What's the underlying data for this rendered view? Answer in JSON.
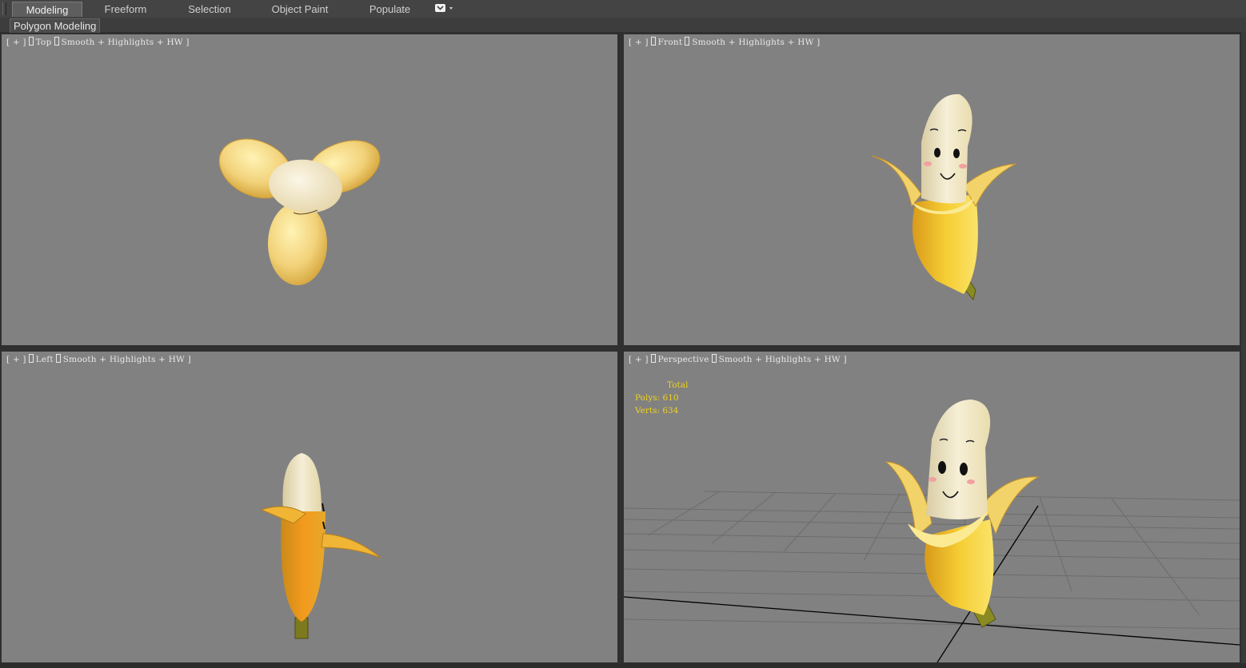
{
  "ribbon": {
    "tabs": [
      {
        "label": "Modeling",
        "active": true
      },
      {
        "label": "Freeform",
        "active": false
      },
      {
        "label": "Selection",
        "active": false
      },
      {
        "label": "Object Paint",
        "active": false
      },
      {
        "label": "Populate",
        "active": false
      }
    ],
    "menu_icon": "dropdown-toggle-icon",
    "panel_label": "Polygon Modeling"
  },
  "viewports": {
    "top": {
      "plus": "[ + ]",
      "view": "Top",
      "shading": "Smooth + Highlights + HW ]"
    },
    "front": {
      "plus": "[ + ]",
      "view": "Front",
      "shading": "Smooth + Highlights + HW ]"
    },
    "left": {
      "plus": "[ + ]",
      "view": "Left",
      "shading": "Smooth + Highlights + HW ]"
    },
    "perspective": {
      "plus": "[ + ]",
      "view": "Perspective",
      "shading": "Smooth + Highlights + HW ]"
    }
  },
  "stats": {
    "header": "Total",
    "polys_label": "Polys:",
    "polys": "610",
    "verts_label": "Verts:",
    "verts": "634"
  },
  "colors": {
    "viewport_bg": "#818181",
    "stats_text": "#f0d21e",
    "peel": "#f1c734",
    "flesh": "#f4e8c4",
    "stem": "#7a7a1e"
  }
}
